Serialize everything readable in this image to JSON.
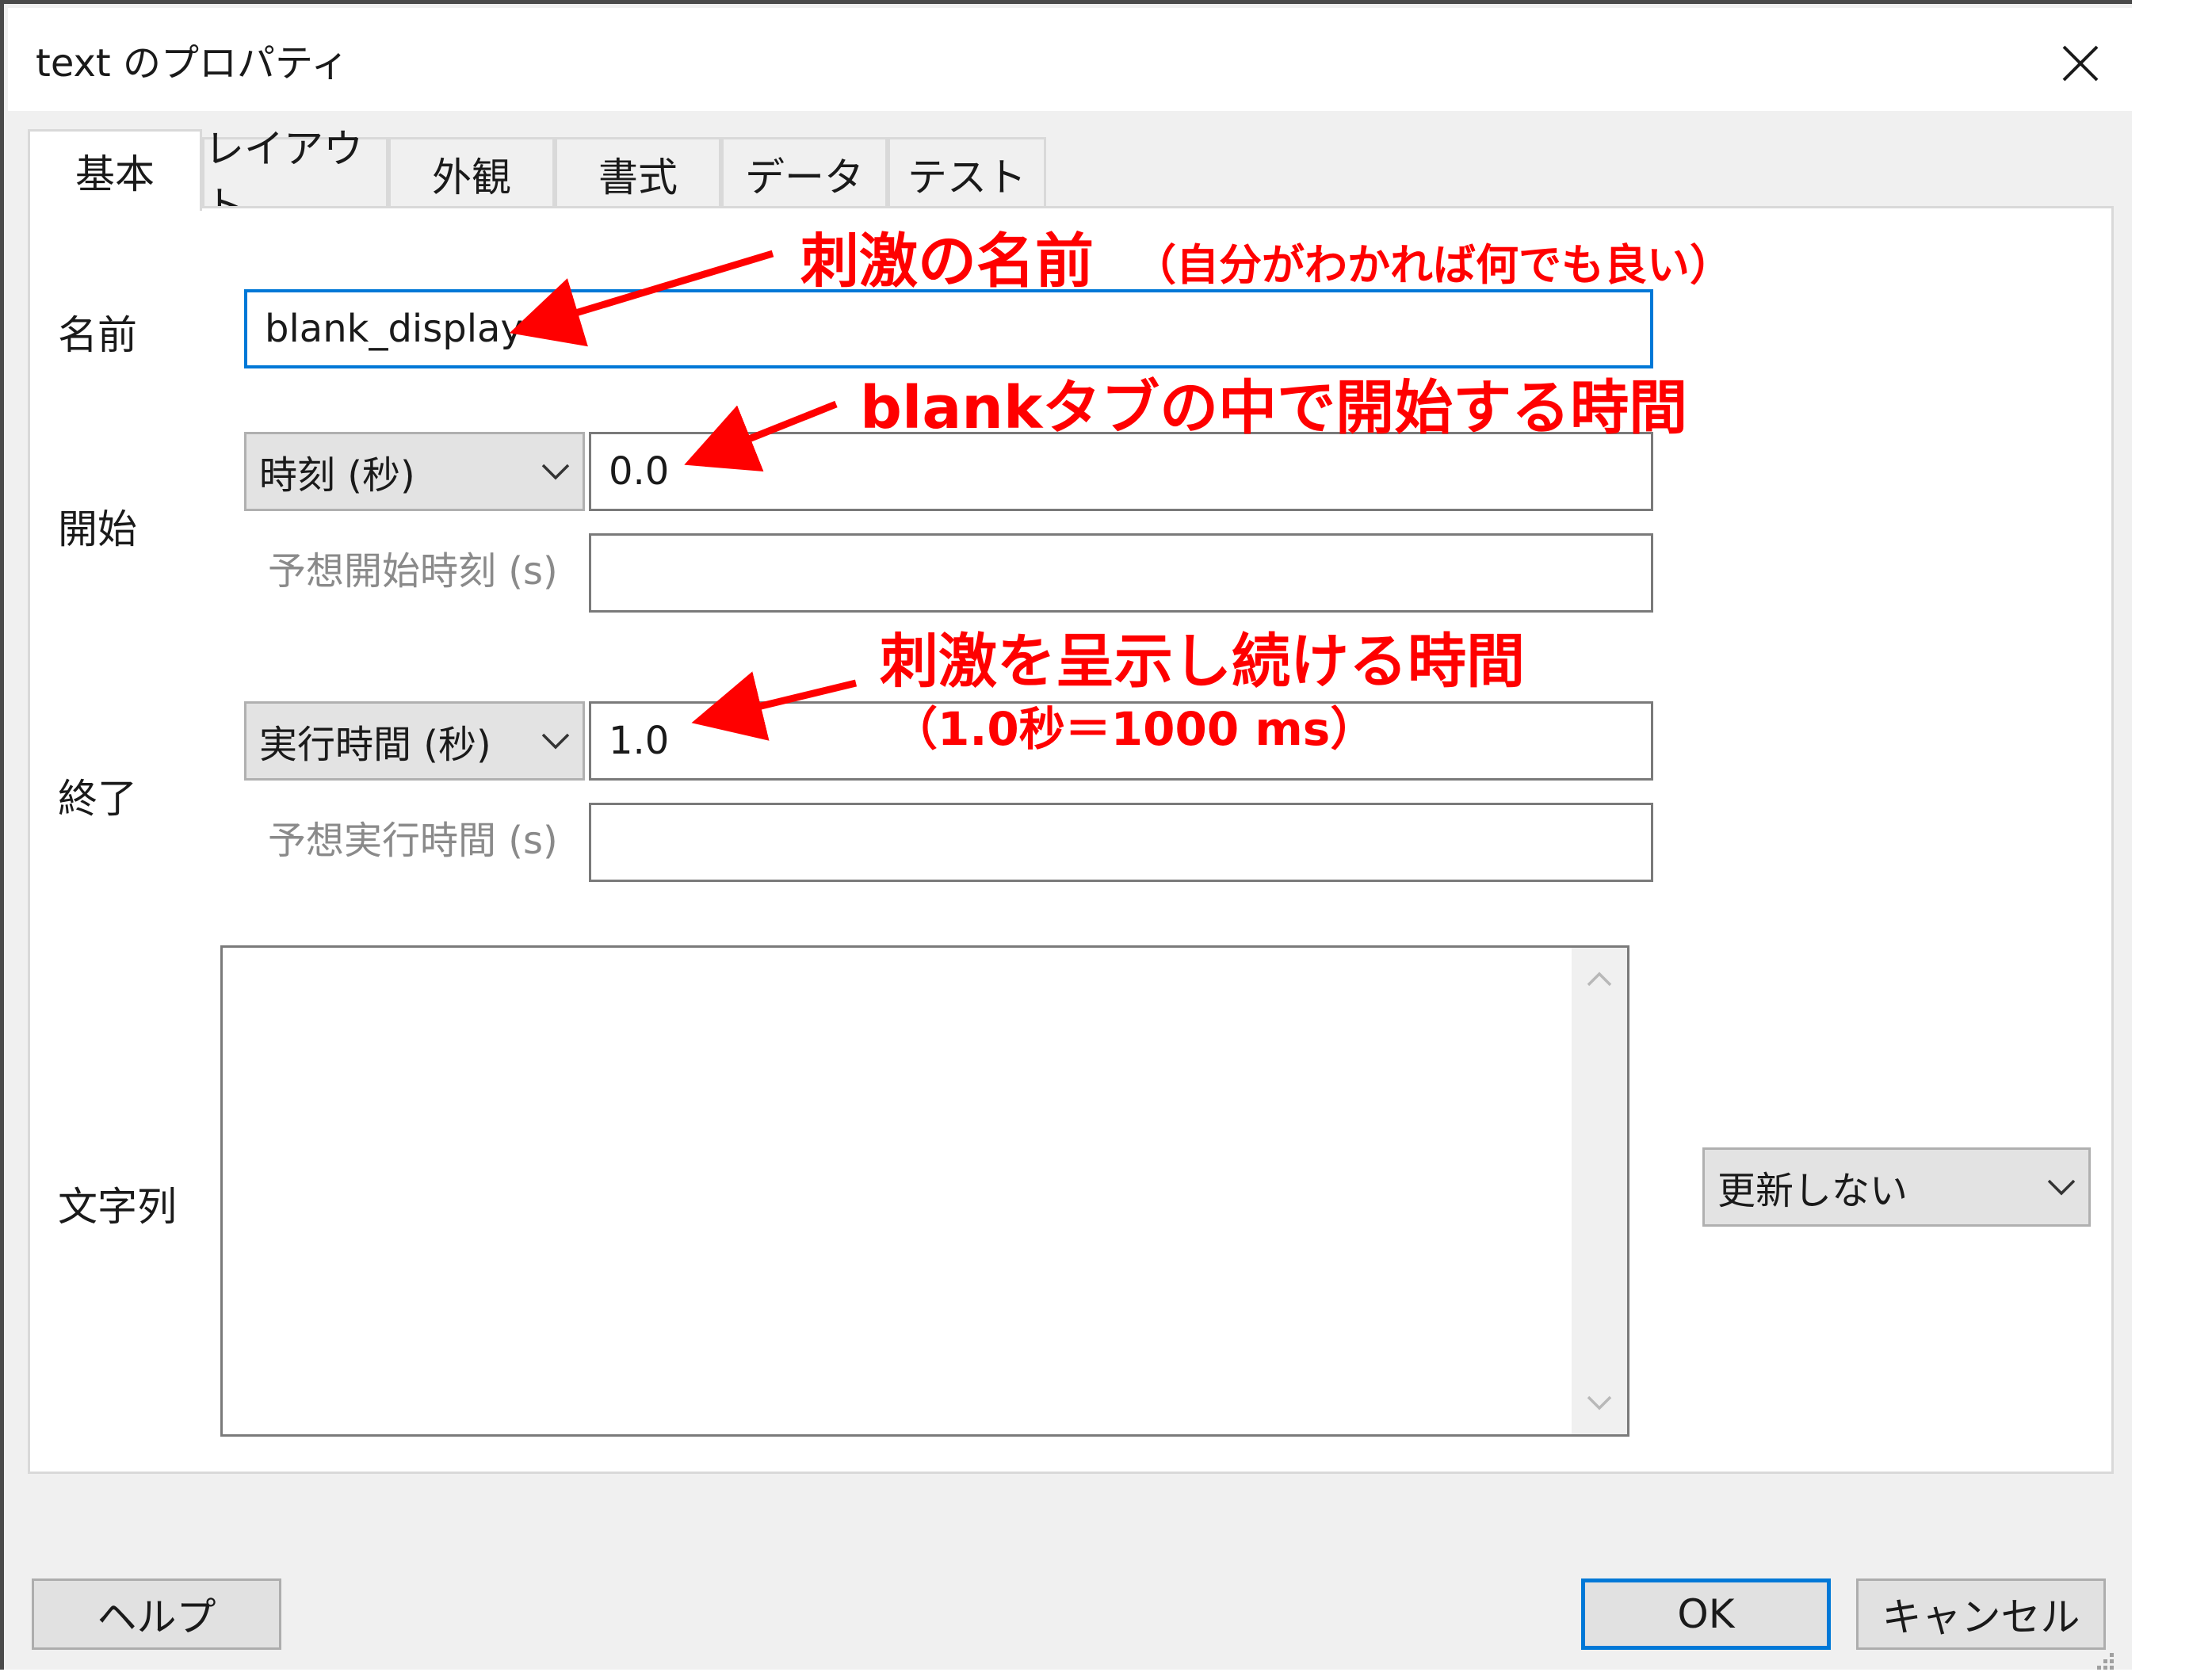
{
  "window": {
    "title": "text のプロパティ"
  },
  "tabs": [
    {
      "label": "基本",
      "active": true
    },
    {
      "label": "レイアウト"
    },
    {
      "label": "外観"
    },
    {
      "label": "書式"
    },
    {
      "label": "データ"
    },
    {
      "label": "テスト"
    }
  ],
  "fields": {
    "name": {
      "label": "名前",
      "value": "blank_display"
    },
    "start": {
      "label": "開始",
      "type_selected": "時刻 (秒)",
      "value": "0.0",
      "expected_label": "予想開始時刻 (s)",
      "expected_value": ""
    },
    "stop": {
      "label": "終了",
      "type_selected": "実行時間 (秒)",
      "value": "1.0",
      "expected_label": "予想実行時間 (s)",
      "expected_value": ""
    },
    "text": {
      "label": "文字列",
      "value": "",
      "update_selected": "更新しない"
    }
  },
  "buttons": {
    "help": "ヘルプ",
    "ok": "OK",
    "cancel": "キャンセル"
  },
  "annotations": {
    "name_main": "刺激の名前",
    "name_sub": "（自分がわかれば何でも良い）",
    "start": "blankタブの中で開始する時間",
    "duration": "刺激を呈示し続ける時間",
    "duration_sub": "（1.0秒＝1000 ms）"
  },
  "colors": {
    "annotation": "#ff0000",
    "focus": "#0078d7"
  }
}
